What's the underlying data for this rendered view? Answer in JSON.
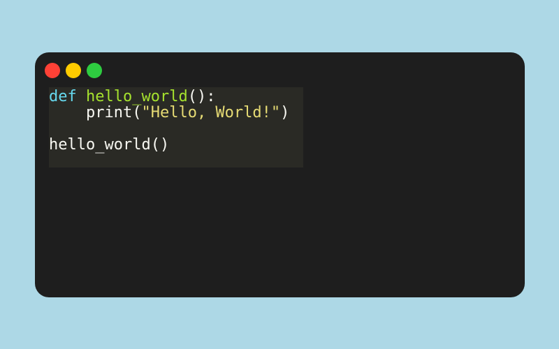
{
  "code": {
    "line1": {
      "keyword": "def",
      "name": "hello_world",
      "tail": "():"
    },
    "line2": {
      "indent": "    ",
      "call": "print(",
      "string": "\"Hello, World!\"",
      "close": ")"
    },
    "line4": {
      "text": "hello_world()"
    }
  },
  "window_controls": {
    "close_color": "#ff4136",
    "minimize_color": "#ffcc00",
    "maximize_color": "#2ecc40"
  },
  "colors": {
    "page_background": "#add8e6",
    "window_background": "#1e1e1e",
    "code_background": "#2a2a25",
    "keyword": "#66d9ef",
    "function_name": "#a6e22e",
    "string": "#e6db74",
    "default_text": "#f8f8f2"
  }
}
